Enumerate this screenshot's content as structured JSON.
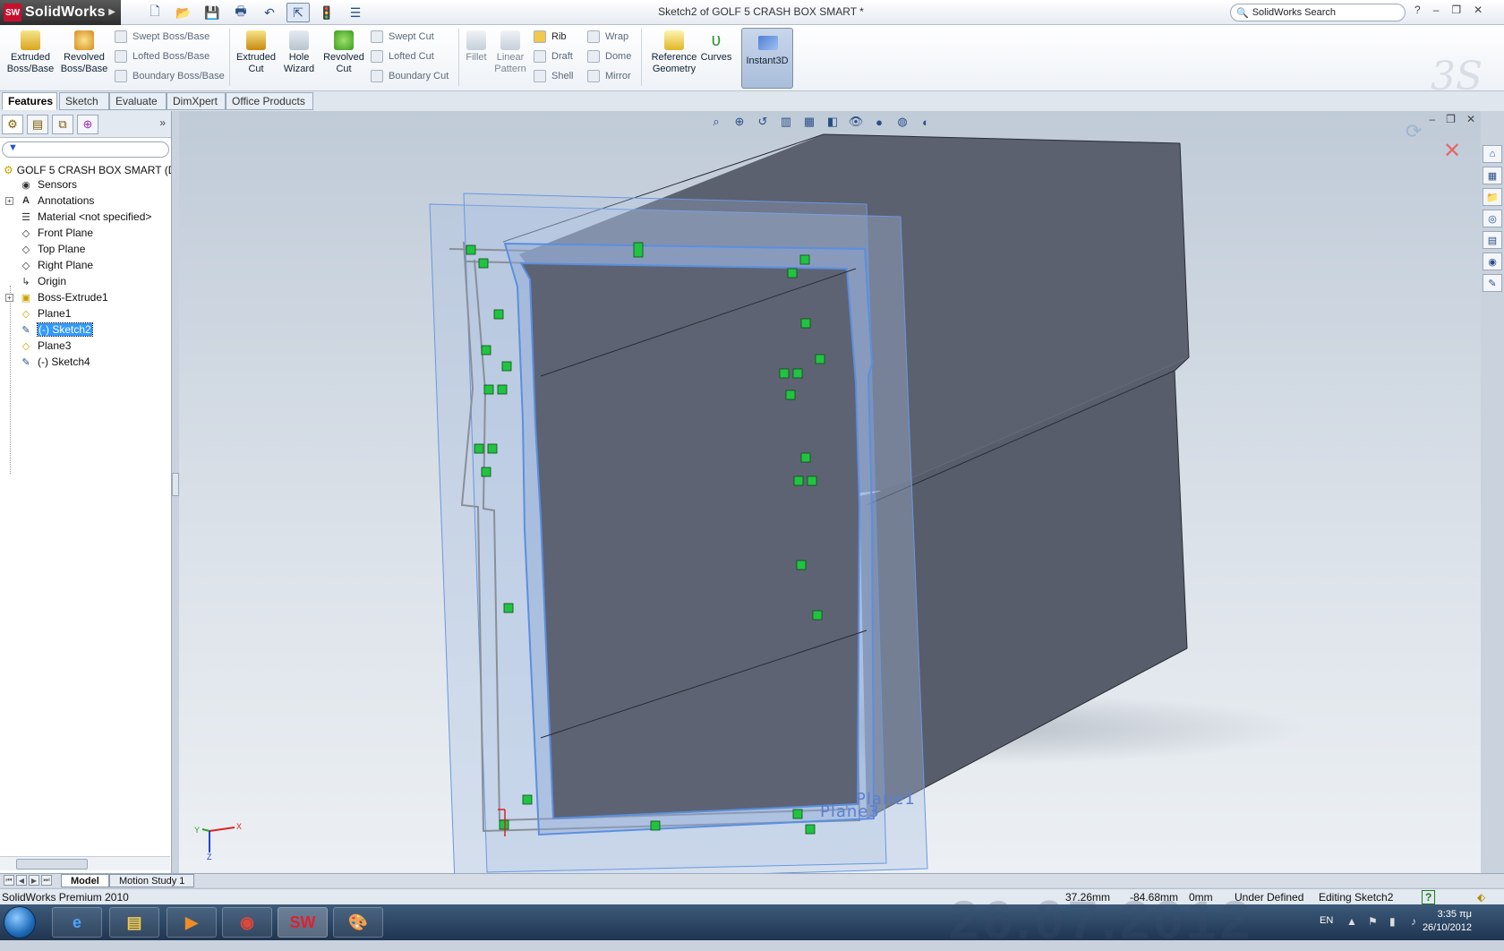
{
  "app": {
    "name": "SolidWorks",
    "logo_badge": "SW",
    "window_title": "Sketch2 of GOLF 5 CRASH BOX SMART *",
    "search_placeholder": "SolidWorks Search"
  },
  "ribbon": {
    "big_buttons": [
      {
        "label": "Extruded Boss/Base",
        "icon": "extruded-boss-icon"
      },
      {
        "label": "Revolved Boss/Base",
        "icon": "revolved-boss-icon"
      },
      {
        "label": "Extruded Cut",
        "icon": "extruded-cut-icon"
      },
      {
        "label": "Hole Wizard",
        "icon": "hole-wizard-icon"
      },
      {
        "label": "Revolved Cut",
        "icon": "revolved-cut-icon"
      },
      {
        "label": "Fillet",
        "icon": "fillet-icon"
      },
      {
        "label": "Linear Pattern",
        "icon": "linear-pattern-icon"
      },
      {
        "label": "Reference Geometry",
        "icon": "reference-geometry-icon"
      },
      {
        "label": "Curves",
        "icon": "curves-icon"
      },
      {
        "label": "Instant3D",
        "icon": "instant3d-icon"
      }
    ],
    "small_buttons": [
      "Swept Boss/Base",
      "Lofted Boss/Base",
      "Boundary Boss/Base",
      "Swept Cut",
      "Lofted Cut",
      "Boundary Cut",
      "Rib",
      "Draft",
      "Shell",
      "Wrap",
      "Dome",
      "Mirror"
    ]
  },
  "command_tabs": [
    "Features",
    "Sketch",
    "Evaluate",
    "DimXpert",
    "Office Products"
  ],
  "feature_tree": {
    "filter_symbol": "▼",
    "root": "GOLF 5 CRASH BOX SMART  (De",
    "items": [
      {
        "label": "Sensors",
        "icon": "sensor-icon"
      },
      {
        "label": "Annotations",
        "icon": "annotations-icon",
        "expandable": true
      },
      {
        "label": "Material <not specified>",
        "icon": "material-icon"
      },
      {
        "label": "Front Plane",
        "icon": "plane-icon"
      },
      {
        "label": "Top Plane",
        "icon": "plane-icon"
      },
      {
        "label": "Right Plane",
        "icon": "plane-icon"
      },
      {
        "label": "Origin",
        "icon": "origin-icon"
      },
      {
        "label": "Boss-Extrude1",
        "icon": "extrude-icon",
        "expandable": true
      },
      {
        "label": "Plane1",
        "icon": "plane-icon"
      },
      {
        "label": "(-) Sketch2",
        "icon": "sketch-icon",
        "selected": true
      },
      {
        "label": "Plane3",
        "icon": "plane-icon"
      },
      {
        "label": "(-) Sketch4",
        "icon": "sketch-icon"
      }
    ]
  },
  "viewport": {
    "plane_labels": [
      "Plane1",
      "Plane3"
    ],
    "triad_axes": [
      "Y",
      "X",
      "Z"
    ]
  },
  "bottom_tabs": [
    "Model",
    "Motion Study 1"
  ],
  "status": {
    "product": "SolidWorks Premium 2010",
    "x": "37.26mm",
    "y": "-84.68mm",
    "z": "0mm",
    "state": "Under Defined",
    "mode": "Editing Sketch2",
    "help": "?"
  },
  "taskbar": {
    "lang": "EN",
    "time": "3:35 πμ",
    "date": "26/10/2012",
    "wallpaper_date": "26.07.2012"
  },
  "colors": {
    "body": "#5a5f6e",
    "sketch_blue": "#5b8fe0",
    "relation_green": "#21c341"
  }
}
